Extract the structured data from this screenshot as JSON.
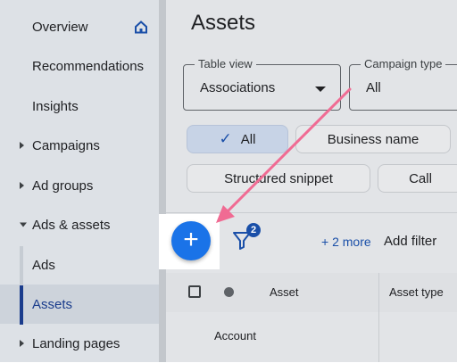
{
  "sidebar": {
    "items": [
      {
        "label": "Overview"
      },
      {
        "label": "Recommendations"
      },
      {
        "label": "Insights"
      },
      {
        "label": "Campaigns"
      },
      {
        "label": "Ad groups"
      },
      {
        "label": "Ads & assets"
      },
      {
        "label": "Ads"
      },
      {
        "label": "Assets"
      },
      {
        "label": "Landing pages"
      }
    ]
  },
  "main": {
    "title": "Assets",
    "table_view": {
      "label": "Table view",
      "value": "Associations"
    },
    "campaign_type": {
      "label": "Campaign type",
      "value": "All"
    },
    "chips": [
      "All",
      "Business name",
      "Structured snippet",
      "Call"
    ],
    "filter_badge": "2",
    "more_link": "+ 2 more",
    "add_filter": "Add filter",
    "add_button": "+",
    "table": {
      "headers": [
        "Asset",
        "Asset type"
      ],
      "rows": [
        {
          "asset": "Account"
        }
      ]
    }
  },
  "colors": {
    "accent": "#1a73e8",
    "annotation_arrow": "#f06b93",
    "active_rail": "#1a3c8c"
  },
  "icons": [
    "home-icon",
    "check-icon",
    "filter-icon",
    "plus-icon",
    "chevron-right-icon",
    "chevron-down-icon"
  ]
}
